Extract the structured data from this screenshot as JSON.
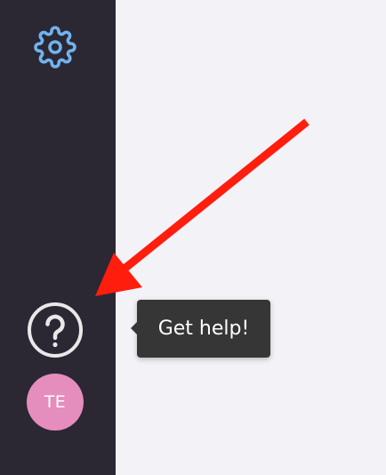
{
  "sidebar": {
    "settings_icon": "gear-icon",
    "settings_color": "#6fb3ee",
    "help_icon": "question-circle-icon",
    "help_color": "#e8e8e8",
    "background": "#2b2733"
  },
  "tooltip": {
    "text": "Get help!"
  },
  "user": {
    "initials": "TE",
    "avatar_color": "#e58dbd"
  },
  "annotation": {
    "arrow_color": "#ff1d0d"
  }
}
